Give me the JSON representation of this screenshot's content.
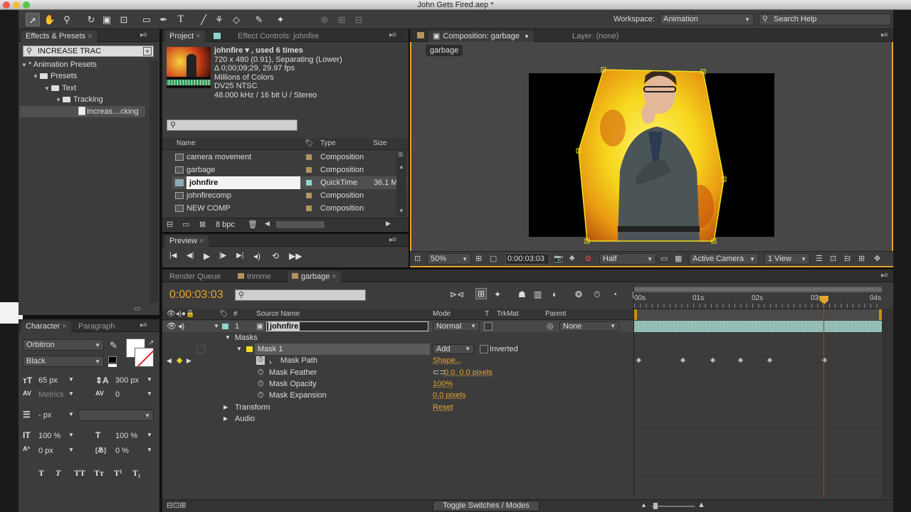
{
  "window": {
    "title": "John Gets Fired.aep *"
  },
  "toolbar": {
    "workspace_label": "Workspace:",
    "workspace_value": "Animation",
    "search_placeholder": "Search Help"
  },
  "effects": {
    "tab": "Effects & Presets",
    "search_value": "INCREASE TRAC",
    "tree": [
      {
        "label": "* Animation Presets",
        "indent": 0
      },
      {
        "label": "Presets",
        "indent": 1
      },
      {
        "label": "Text",
        "indent": 2
      },
      {
        "label": "Tracking",
        "indent": 3
      },
      {
        "label": "Increas…cking",
        "indent": 4
      }
    ]
  },
  "project": {
    "tab": "Project",
    "tab2": "Effect Controls: johnfire",
    "footage": {
      "name": "johnfire ▾ , used 6 times",
      "line1": "720 x 480 (0.91), Separating (Lower)",
      "line2": "Δ 0;00;09;29, 29.97 fps",
      "line3": "Millions of Colors",
      "line4": "DV25 NTSC",
      "line5": "48.000 kHz / 16 bit U / Stereo"
    },
    "headers": {
      "name": "Name",
      "type": "Type",
      "size": "Size"
    },
    "items": [
      {
        "name": "camera movement",
        "type": "Composition",
        "size": ""
      },
      {
        "name": "garbage",
        "type": "Composition",
        "size": ""
      },
      {
        "name": "johnfire",
        "type": "QuickTime",
        "size": "36.1 M"
      },
      {
        "name": "johnfirecomp",
        "type": "Composition",
        "size": ""
      },
      {
        "name": "NEW COMP",
        "type": "Composition",
        "size": ""
      }
    ],
    "bpc": "8 bpc"
  },
  "preview": {
    "tab": "Preview"
  },
  "composition": {
    "tab": "Composition: garbage",
    "layer_tab": "Layer: (none)",
    "comp_button": "garbage",
    "zoom": "50%",
    "timecode": "0:00:03:03",
    "resolution": "Half",
    "camera": "Active Camera",
    "views": "1 View"
  },
  "character": {
    "tab": "Character",
    "tab2": "Paragraph",
    "font": "Orbitron",
    "style": "Black",
    "size": "65 px",
    "leading": "300 px",
    "kerning": "Metrics",
    "tracking": "0",
    "stroke": "- px",
    "vscale": "100 %",
    "hscale": "100 %",
    "baseline": "0 px",
    "tsume": "0 %",
    "styles": [
      "T",
      "T",
      "TT",
      "Tт",
      "T¹",
      "T₁"
    ]
  },
  "timeline": {
    "tabs": [
      "Render Queue",
      "trimme",
      "garbage"
    ],
    "timecode": "0:00:03:03",
    "headers": {
      "source": "Source Name",
      "mode": "Mode",
      "t": "T",
      "trkmat": "TrkMat",
      "parent": "Parent"
    },
    "layer": {
      "num": "1",
      "name": "johnfire",
      "mode": "Normal",
      "parent": "None"
    },
    "masks_label": "Masks",
    "mask1": "Mask 1",
    "mask_mode": "Add",
    "inverted": "Inverted",
    "props": [
      {
        "name": "Mask Path",
        "value": "Shape..."
      },
      {
        "name": "Mask Feather",
        "value": "0.0, 0.0 pixels"
      },
      {
        "name": "Mask Opacity",
        "value": "100%"
      },
      {
        "name": "Mask Expansion",
        "value": "0.0 pixels"
      }
    ],
    "transform": "Transform",
    "transform_value": "Reset",
    "audio": "Audio",
    "ruler": [
      "00s",
      "01s",
      "02s",
      "03s",
      "04s"
    ],
    "toggle": "Toggle Switches / Modes"
  },
  "colors": {
    "accent": "#e6a52e",
    "panel": "#3c3c3c",
    "playhead": "#d0321e"
  }
}
